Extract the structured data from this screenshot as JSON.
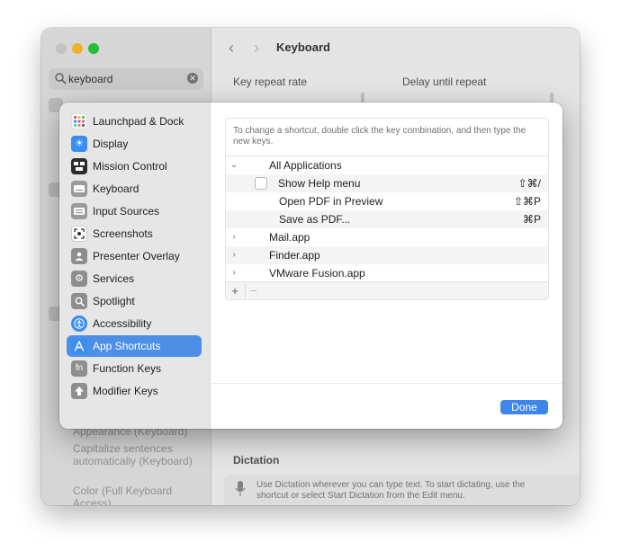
{
  "window": {
    "title": "Keyboard",
    "search": {
      "value": "keyboard",
      "placeholder": "Search"
    },
    "labels": {
      "key_repeat_rate": "Key repeat rate",
      "delay_until_repeat": "Delay until repeat"
    },
    "sidebar_results": [
      "Appearance (Keyboard)",
      "Capitalize sentences automatically (Keyboard)",
      "Color (Full Keyboard Access)"
    ],
    "dictation": {
      "heading": "Dictation",
      "description": "Use Dictation wherever you can type text. To start dictating, use the shortcut or select Start Dictation from the Edit menu."
    }
  },
  "sheet": {
    "categories": [
      {
        "label": "Launchpad & Dock",
        "icon": "launchpad-icon",
        "color": "#ffffff"
      },
      {
        "label": "Display",
        "icon": "display-icon",
        "color": "#3a8ef0"
      },
      {
        "label": "Mission Control",
        "icon": "mission-control-icon",
        "color": "#2b2b2b"
      },
      {
        "label": "Keyboard",
        "icon": "keyboard-icon",
        "color": "#9a9a9a"
      },
      {
        "label": "Input Sources",
        "icon": "input-sources-icon",
        "color": "#9a9a9a"
      },
      {
        "label": "Screenshots",
        "icon": "screenshots-icon",
        "color": "#ffffff"
      },
      {
        "label": "Presenter Overlay",
        "icon": "presenter-overlay-icon",
        "color": "#8e8e8e"
      },
      {
        "label": "Services",
        "icon": "services-icon",
        "color": "#8e8e8e"
      },
      {
        "label": "Spotlight",
        "icon": "spotlight-icon",
        "color": "#8e8e8e"
      },
      {
        "label": "Accessibility",
        "icon": "accessibility-icon",
        "color": "#3a8ef0"
      },
      {
        "label": "App Shortcuts",
        "icon": "app-shortcuts-icon",
        "color": "#3a8ef0",
        "selected": true
      },
      {
        "label": "Function Keys",
        "icon": "function-keys-icon",
        "color": "#8e8e8e"
      },
      {
        "label": "Modifier Keys",
        "icon": "modifier-keys-icon",
        "color": "#8e8e8e"
      }
    ],
    "instruction": "To change a shortcut, double click the key combination, and then type the new keys.",
    "rows": [
      {
        "label": "All Applications",
        "shortcut": "",
        "disclosure": "⌄"
      },
      {
        "label": "Show Help menu",
        "shortcut": "⇧⌘/",
        "checkbox": true
      },
      {
        "label": "Open PDF in Preview",
        "shortcut": "⇧⌘P"
      },
      {
        "label": "Save as PDF...",
        "shortcut": "⌘P"
      },
      {
        "label": "Mail.app",
        "shortcut": "",
        "disclosure": "›"
      },
      {
        "label": "Finder.app",
        "shortcut": "",
        "disclosure": "›"
      },
      {
        "label": "VMware Fusion.app",
        "shortcut": "",
        "disclosure": "›"
      }
    ],
    "add_label": "+",
    "remove_label": "−",
    "done_label": "Done"
  }
}
